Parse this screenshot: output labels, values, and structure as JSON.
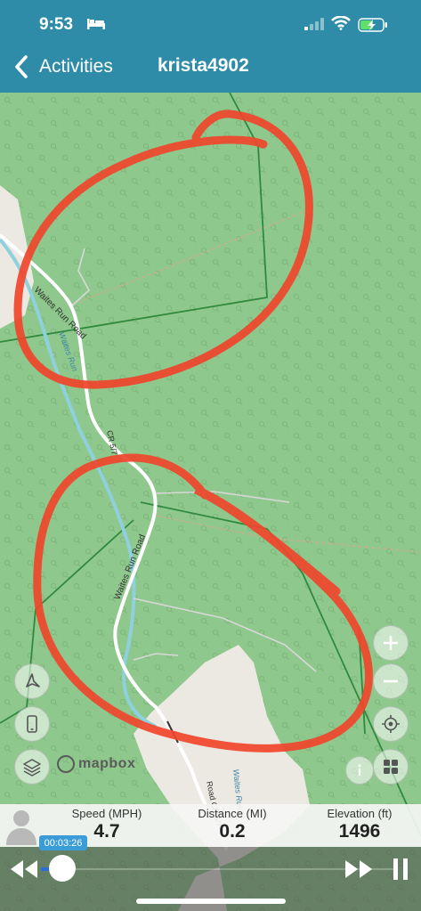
{
  "status_bar": {
    "time": "9:53"
  },
  "nav": {
    "back_label": "Activities",
    "title": "krista4902"
  },
  "map": {
    "road_labels": [
      "Waites Run Road",
      "CR 5/7",
      "Waites Run Road",
      "Waites Run Road",
      "Road CR 5/7"
    ],
    "stream_labels": [
      "Waites Run",
      "Waites Run",
      "Waites Run"
    ],
    "attribution": "mapbox",
    "colors": {
      "forest": "#8fc88d",
      "clearing": "#ece9e3",
      "road": "#ffffff",
      "stream": "#8ed0de",
      "annotation": "#f0452b"
    }
  },
  "stats": {
    "speed": {
      "label": "Speed (MPH)",
      "value": "4.7"
    },
    "distance": {
      "label": "Distance (MI)",
      "value": "0.2"
    },
    "elevation": {
      "label": "Elevation (ft)",
      "value": "1496"
    }
  },
  "playback": {
    "elapsed": "00:03:26",
    "progress": 0.06
  },
  "icons": [
    "bed-icon",
    "signal-icon",
    "wifi-icon",
    "battery-charging-icon",
    "chevron-left-icon",
    "compass-icon",
    "phone-icon",
    "layers-icon",
    "zoom-in-icon",
    "zoom-out-icon",
    "locate-icon",
    "grid-icon",
    "info-icon",
    "user-avatar-icon",
    "rewind-icon",
    "fast-forward-icon",
    "pause-icon"
  ]
}
